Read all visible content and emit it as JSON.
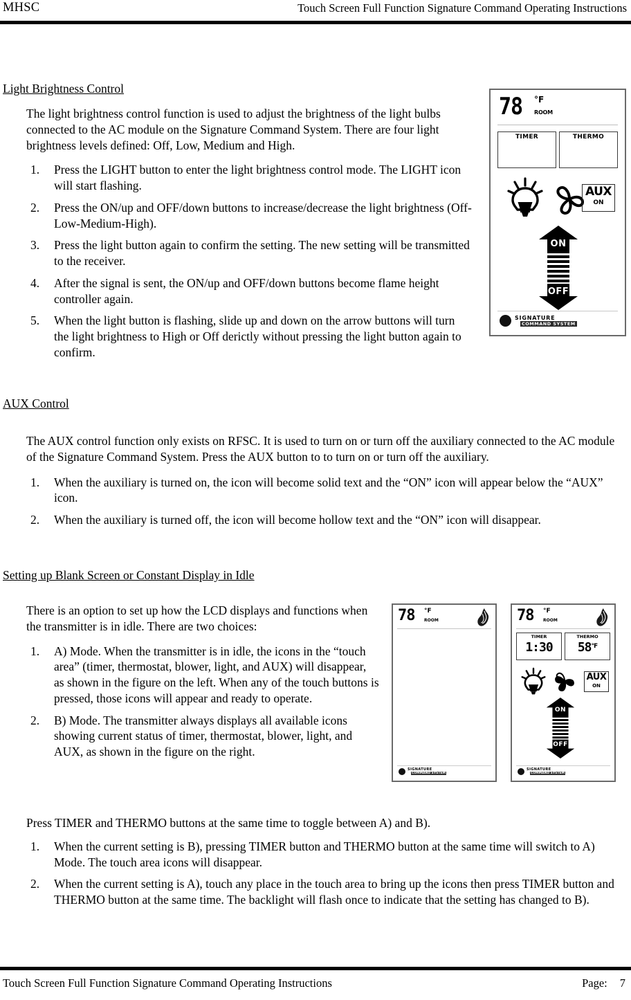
{
  "header": {
    "left": "MHSC",
    "right": "Touch Screen Full Function Signature Command Operating Instructions"
  },
  "footer": {
    "left": "Touch Screen Full Function Signature Command Operating Instructions",
    "page_label": "Page:",
    "page_number": "7"
  },
  "sections": {
    "light_brightness": {
      "heading": "Light Brightness Control",
      "intro": "The light brightness control function is used to adjust the brightness of the light bulbs connected to the AC module on the Signature Command System. There are four light brightness levels defined: Off, Low, Medium and High.",
      "items": [
        {
          "num": "1.",
          "text": "Press the LIGHT button to enter the light brightness control mode. The LIGHT icon will start flashing."
        },
        {
          "num": "2.",
          "text": "Press the ON/up and OFF/down buttons to increase/decrease the light brightness (Off-Low-Medium-High)."
        },
        {
          "num": "3.",
          "text": "Press the light button again to confirm the setting. The new setting will be transmitted to the receiver."
        },
        {
          "num": "4.",
          "text": "After the signal is sent, the ON/up and OFF/down buttons become flame height controller again."
        },
        {
          "num": "5.",
          "text": "When the light button is flashing, slide up and down on the arrow buttons will turn the light brightness to High or Off derictly without pressing the light button again to confirm."
        }
      ]
    },
    "aux_control": {
      "heading": "AUX Control",
      "intro": "The AUX control function only exists on RFSC. It is used to turn on or turn off the auxiliary connected to the AC module of the Signature Command System. Press the AUX button to to turn on or turn off the auxiliary.",
      "items": [
        {
          "num": "1.",
          "text": "When the auxiliary is turned on, the icon will become solid text and the “ON” icon will appear below the “AUX” icon."
        },
        {
          "num": "2.",
          "text": "When the auxiliary is turned off, the icon will become hollow text and the “ON” icon will disappear."
        }
      ]
    },
    "blank_screen": {
      "heading": "Setting up Blank Screen or Constant Display in Idle",
      "intro": "There is an option to set up how the LCD displays and functions when the transmitter is in idle. There are two choices:",
      "items": [
        {
          "num": "1.",
          "text": "A) Mode. When the transmitter is in idle, the icons in the “touch area” (timer, thermostat, blower, light, and AUX) will disappear, as shown in the figure on the left. When any of the touch buttons is pressed, those icons will appear and ready to operate."
        },
        {
          "num": "2.",
          "text": "B) Mode. The transmitter always displays all available icons showing current status of timer, thermostat, blower, light, and AUX, as shown in the figure on the right."
        }
      ],
      "toggle_note": "Press TIMER and THERMO buttons at the same time to toggle between A) and B).",
      "toggle_items": [
        {
          "num": "1.",
          "text": "When the current setting is B), pressing TIMER button and THERMO button at the same time will switch to A) Mode. The touch area icons will disappear."
        },
        {
          "num": "2.",
          "text": "When the current setting is A), touch any place in the touch area to bring up the icons then press TIMER button and THERMO button at the same time. The backlight will flash once to indicate that the setting has changed to B)."
        }
      ]
    }
  },
  "figures": {
    "transmitter_main": {
      "temperature": "78",
      "temperature_unit": "°F",
      "temperature_source": "ROOM",
      "timer": {
        "label": "TIMER",
        "value": ""
      },
      "thermo": {
        "label": "THERMO",
        "value": ""
      },
      "aux": {
        "label": "AUX",
        "status": "ON"
      },
      "slider": {
        "up_label": "ON",
        "down_label": "OFF"
      },
      "logo_line1": "SIGNATURE",
      "logo_line2": "COMMAND  SYSTEM"
    },
    "mode_a": {
      "temperature": "78",
      "temperature_unit": "°F",
      "temperature_source": "ROOM",
      "logo_line1": "SIGNATURE",
      "logo_line2": "COMMAND SYSTEM"
    },
    "mode_b": {
      "temperature": "78",
      "temperature_unit": "°F",
      "temperature_source": "ROOM",
      "timer": {
        "label": "TIMER",
        "value": "1:30"
      },
      "thermo": {
        "label": "THERMO",
        "value": "58",
        "unit": "°F"
      },
      "aux": {
        "label": "AUX",
        "status": "ON"
      },
      "slider": {
        "up_label": "ON",
        "down_label": "OFF"
      },
      "logo_line1": "SIGNATURE",
      "logo_line2": "COMMAND SYSTEM"
    }
  },
  "colors": {
    "text": "#000000",
    "rule": "#000000",
    "device_border": "#6a6a6a",
    "lcd_border": "#3a3a3a",
    "page_background": "#ffffff"
  }
}
